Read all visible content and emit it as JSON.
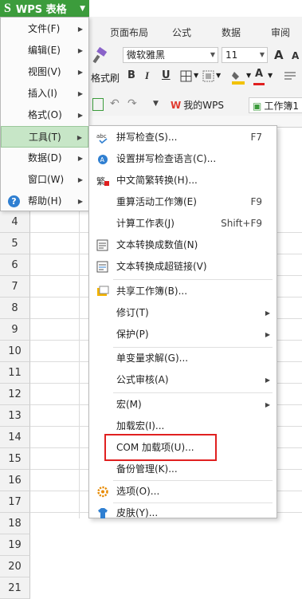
{
  "app": {
    "title": "WPS 表格",
    "logo": "S"
  },
  "ribbon_tabs": [
    "页面布局",
    "公式",
    "数据",
    "审阅"
  ],
  "ribbon": {
    "font_name": "微软雅黑",
    "font_size": "11",
    "format_painter": "格式刷",
    "bold": "B",
    "italic": "I",
    "underline": "U",
    "grow_font": "A",
    "shrink_font": "A",
    "font_color": "A"
  },
  "doc_tabs": {
    "home": "我的WPS",
    "workbook": "工作簿1"
  },
  "main_menu": [
    {
      "label": "文件(F)",
      "submenu": true
    },
    {
      "label": "编辑(E)",
      "submenu": true
    },
    {
      "label": "视图(V)",
      "submenu": true
    },
    {
      "label": "插入(I)",
      "submenu": true
    },
    {
      "label": "格式(O)",
      "submenu": true
    },
    {
      "label": "工具(T)",
      "submenu": true,
      "active": true
    },
    {
      "label": "数据(D)",
      "submenu": true
    },
    {
      "label": "窗口(W)",
      "submenu": true
    },
    {
      "label": "帮助(H)",
      "submenu": true,
      "icon": "help-icon"
    }
  ],
  "tools_menu": [
    {
      "label": "拼写检查(S)...",
      "shortcut": "F7",
      "icon": "spellcheck-icon"
    },
    {
      "label": "设置拼写检查语言(C)...",
      "icon": "language-icon"
    },
    {
      "label": "中文简繁转换(H)...",
      "icon": "convert-icon"
    },
    {
      "label": "重算活动工作簿(E)",
      "shortcut": "F9"
    },
    {
      "label": "计算工作表(J)",
      "shortcut": "Shift+F9"
    },
    {
      "label": "文本转换成数值(N)",
      "icon": "text-to-number-icon"
    },
    {
      "label": "文本转换成超链接(V)",
      "icon": "text-to-link-icon"
    },
    {
      "label": "共享工作簿(B)...",
      "icon": "share-icon"
    },
    {
      "label": "修订(T)",
      "submenu": true
    },
    {
      "label": "保护(P)",
      "submenu": true
    },
    {
      "label": "单变量求解(G)..."
    },
    {
      "label": "公式审核(A)",
      "submenu": true
    },
    {
      "label": "宏(M)",
      "submenu": true
    },
    {
      "label": "加载宏(I)..."
    },
    {
      "label": "COM 加载项(U)...",
      "highlighted": true
    },
    {
      "label": "备份管理(K)..."
    },
    {
      "label": "选项(O)...",
      "icon": "gear-icon"
    },
    {
      "label": "皮肤(Y)...",
      "icon": "skin-icon"
    }
  ],
  "row_numbers": [
    "4",
    "5",
    "6",
    "7",
    "8",
    "9",
    "10",
    "11",
    "12",
    "13",
    "14",
    "15",
    "16",
    "17",
    "18",
    "19",
    "20",
    "21"
  ],
  "colors": {
    "accent": "#3c9c3c",
    "active_bg": "#c7e6c7",
    "highlight": "#e02020"
  }
}
